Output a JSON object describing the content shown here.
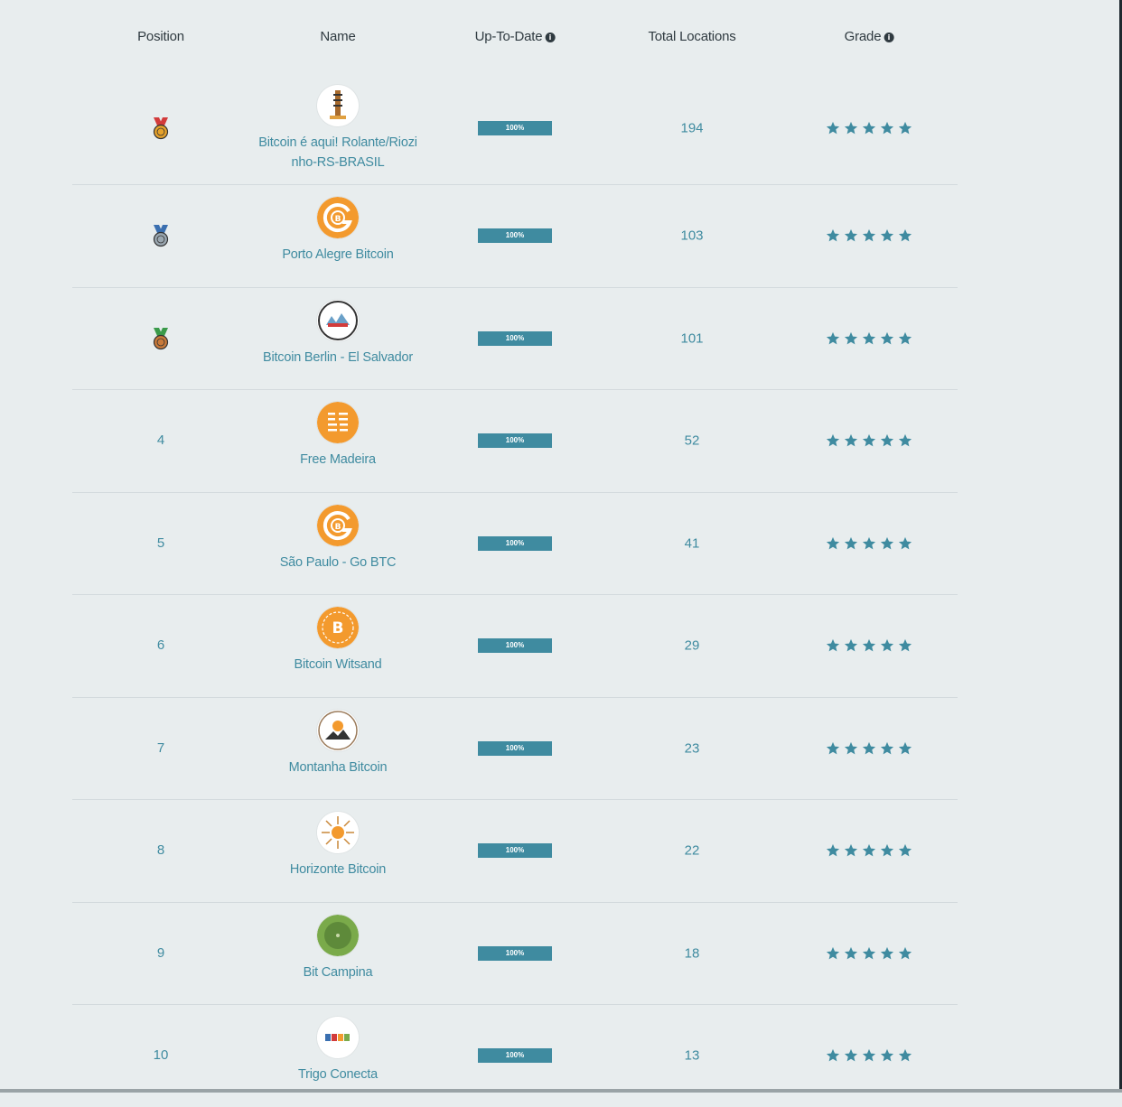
{
  "header": {
    "position": "Position",
    "name": "Name",
    "uptodate": "Up-To-Date",
    "locations": "Total Locations",
    "grade": "Grade"
  },
  "colors": {
    "accent": "#3f8ba0",
    "background": "#e8edee",
    "gold_medal": "#e6a22b",
    "silver_medal": "#9aa7b0",
    "bronze_medal": "#c97a3a"
  },
  "rows": [
    {
      "position": "1",
      "medal": "gold-medal-icon",
      "name": "Bitcoin é aqui! Rolante/Riozi nho-RS-BRASIL",
      "logo": "tower-logo-icon",
      "uptodate_percent": 100,
      "uptodate_label": "100%",
      "locations": "194",
      "stars": 5
    },
    {
      "position": "2",
      "medal": "silver-medal-icon",
      "name": "Porto Alegre Bitcoin",
      "logo": "orange-c-bitcoin-logo-icon",
      "uptodate_percent": 100,
      "uptodate_label": "100%",
      "locations": "103",
      "stars": 5
    },
    {
      "position": "3",
      "medal": "bronze-medal-icon",
      "name": "Bitcoin Berlin - El Salvador",
      "logo": "berlin-badge-logo-icon",
      "uptodate_percent": 100,
      "uptodate_label": "100%",
      "locations": "101",
      "stars": 5
    },
    {
      "position": "4",
      "name": "Free Madeira",
      "logo": "free-madeira-logo-icon",
      "uptodate_percent": 100,
      "uptodate_label": "100%",
      "locations": "52",
      "stars": 5
    },
    {
      "position": "5",
      "name": "São Paulo - Go BTC",
      "logo": "orange-c-bitcoin-logo-icon",
      "uptodate_percent": 100,
      "uptodate_label": "100%",
      "locations": "41",
      "stars": 5
    },
    {
      "position": "6",
      "name": "Bitcoin Witsand",
      "logo": "bitcoin-witsand-logo-icon",
      "uptodate_percent": 100,
      "uptodate_label": "100%",
      "locations": "29",
      "stars": 5
    },
    {
      "position": "7",
      "name": "Montanha Bitcoin",
      "logo": "mountain-badge-logo-icon",
      "uptodate_percent": 100,
      "uptodate_label": "100%",
      "locations": "23",
      "stars": 5
    },
    {
      "position": "8",
      "name": "Horizonte Bitcoin",
      "logo": "horizonte-logo-icon",
      "uptodate_percent": 100,
      "uptodate_label": "100%",
      "locations": "22",
      "stars": 5
    },
    {
      "position": "9",
      "name": "Bit Campina",
      "logo": "green-circle-logo-icon",
      "uptodate_percent": 100,
      "uptodate_label": "100%",
      "locations": "18",
      "stars": 5
    },
    {
      "position": "10",
      "name": "Trigo Conecta",
      "logo": "trigo-logo-icon",
      "uptodate_percent": 100,
      "uptodate_label": "100%",
      "locations": "13",
      "stars": 5
    }
  ]
}
